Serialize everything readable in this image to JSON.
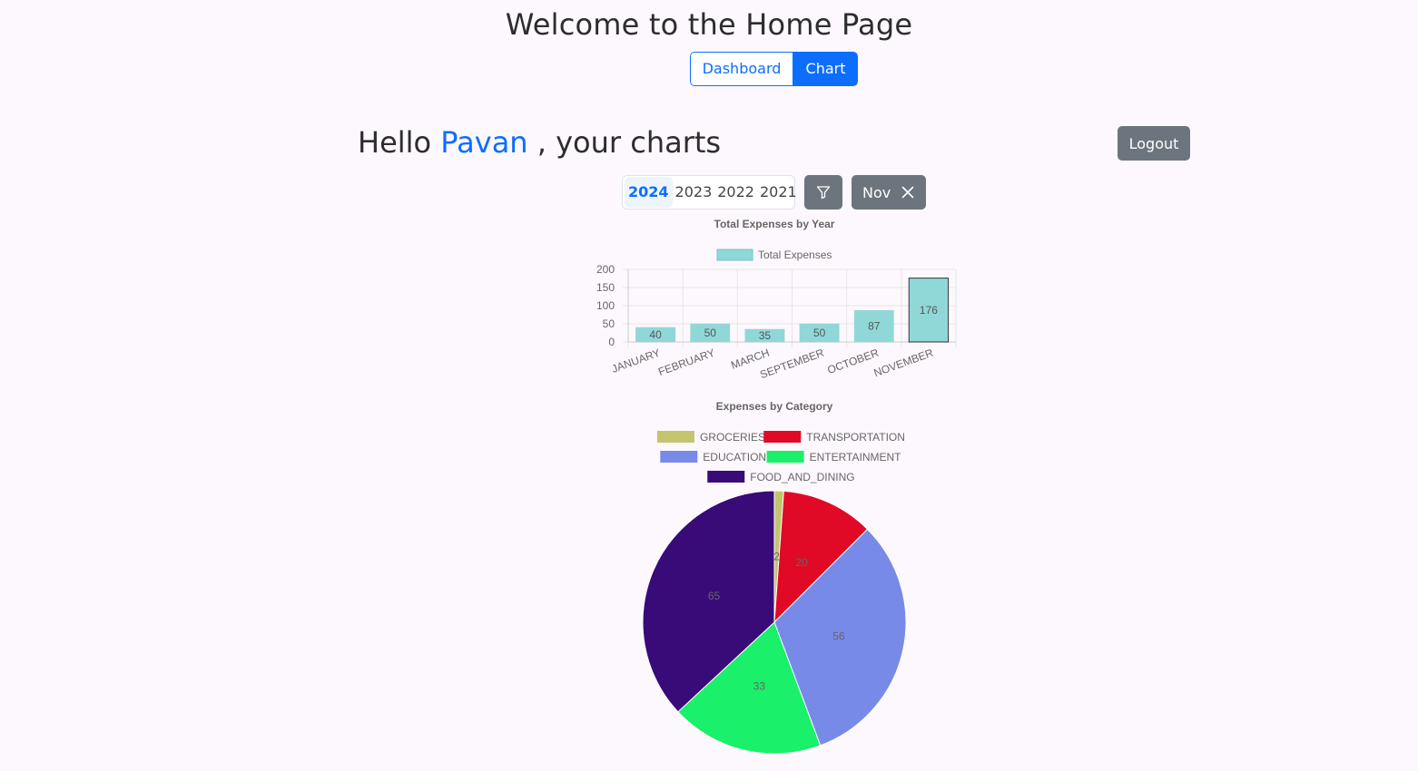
{
  "header": {
    "title": "Welcome to the Home Page",
    "nav": {
      "dashboard": "Dashboard",
      "chart": "Chart"
    }
  },
  "greeting": {
    "prefix": "Hello ",
    "user": "Pavan",
    "suffix": " , your charts"
  },
  "logout_label": "Logout",
  "filters": {
    "years": [
      "2024",
      "2023",
      "2022",
      "2021"
    ],
    "selected_year": "2024",
    "month_chip": "Nov"
  },
  "icons": {
    "filter": "filter-icon",
    "close": "close-icon"
  },
  "colors": {
    "primary": "#0d6efd",
    "secondary": "#6c757d"
  },
  "chart_data": [
    {
      "type": "bar",
      "title": "Total Expenses by Year",
      "categories": [
        "JANUARY",
        "FEBRUARY",
        "MARCH",
        "SEPTEMBER",
        "OCTOBER",
        "NOVEMBER"
      ],
      "series": [
        {
          "name": "Total Expenses",
          "values": [
            40,
            50,
            35,
            50,
            87,
            176
          ],
          "color": "#90d8d8"
        }
      ],
      "ylim": [
        0,
        200
      ],
      "yticks": [
        0,
        50,
        100,
        150,
        200
      ],
      "data_labels": true,
      "grid": true,
      "legend": "top"
    },
    {
      "type": "pie",
      "title": "Expenses by Category",
      "labels": [
        "GROCERIES",
        "TRANSPORTATION",
        "EDUCATION",
        "ENTERTAINMENT",
        "FOOD_AND_DINING"
      ],
      "values": [
        2,
        20,
        56,
        33,
        65
      ],
      "colors": [
        "#c3c46e",
        "#e00a27",
        "#788ae8",
        "#1af069",
        "#380b78"
      ],
      "legend": "top"
    }
  ]
}
